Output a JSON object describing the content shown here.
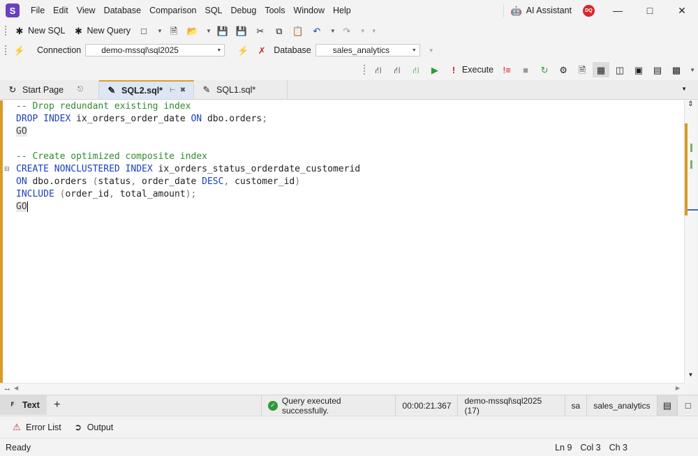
{
  "app": {
    "logo_letter": "S",
    "accent": "#6b3fc1"
  },
  "menu": [
    "File",
    "Edit",
    "View",
    "Database",
    "Comparison",
    "SQL",
    "Debug",
    "Tools",
    "Window",
    "Help"
  ],
  "title_right": {
    "ai_assistant": "AI Assistant",
    "avatar_initials": "DQ"
  },
  "toolbar1": {
    "new_sql": "New SQL",
    "new_query": "New Query"
  },
  "toolbar2": {
    "connection_label": "Connection",
    "connection_value": "demo-mssql\\sql2025",
    "database_label": "Database",
    "database_value": "sales_analytics"
  },
  "toolbar3": {
    "execute": "Execute"
  },
  "tabs": [
    {
      "label": "Start Page"
    },
    {
      "label": "SQL2.sql*"
    },
    {
      "label": "SQL1.sql*"
    }
  ],
  "code_lines": [
    "-- Drop redundant existing index",
    "DROP INDEX ix_orders_order_date ON dbo.orders;",
    "GO",
    "",
    "-- Create optimized composite index",
    "CREATE NONCLUSTERED INDEX ix_orders_status_orderdate_customerid",
    "ON dbo.orders (status, order_date DESC, customer_id)",
    "INCLUDE (order_id, total_amount);",
    "GO"
  ],
  "results": {
    "text_tab": "Text",
    "status_message": "Query executed successfully.",
    "elapsed": "00:00:21.367",
    "server": "demo-mssql\\sql2025 (17)",
    "user": "sa",
    "database": "sales_analytics"
  },
  "bottom_tabs": {
    "error_list": "Error List",
    "output": "Output"
  },
  "statusbar": {
    "ready": "Ready",
    "ln": "Ln 9",
    "col": "Col 3",
    "ch": "Ch 3"
  }
}
